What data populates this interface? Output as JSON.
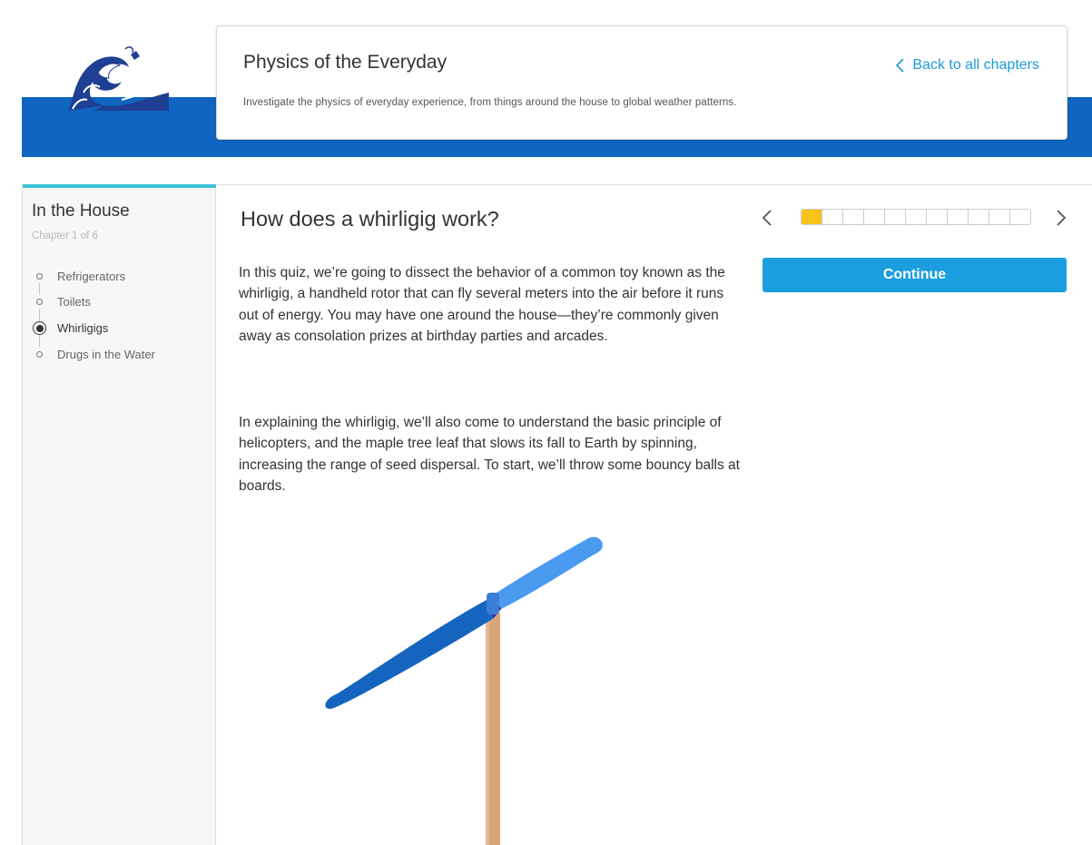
{
  "header": {
    "title": "Physics of the Everyday",
    "description": "Investigate the physics of everyday experience, from things around the house to global weather patterns.",
    "back_link": "Back to all chapters"
  },
  "sidebar": {
    "chapter_title": "In the House",
    "chapter_subtitle": "Chapter 1 of 6",
    "items": [
      {
        "label": "Refrigerators",
        "active": false
      },
      {
        "label": "Toilets",
        "active": false
      },
      {
        "label": "Whirligigs",
        "active": true
      },
      {
        "label": "Drugs in the Water",
        "active": false
      }
    ]
  },
  "quiz": {
    "title": "How does a whirligig work?",
    "paragraphs": [
      "In this quiz, we’re going to dissect the behavior of a common toy known as the whirligig, a handheld rotor that can fly several meters into the air before it runs out of energy. You may have one around the house—they’re commonly given away as consolation prizes at birthday parties and arcades.",
      "In explaining the whirligig, we’ll also come to understand the basic principle of helicopters, and the maple tree leaf that slows its fall to Earth by spinning, increasing the range of seed dispersal. To start, we’ll throw some bouncy balls at boards."
    ]
  },
  "navigation": {
    "continue_label": "Continue",
    "progress_total": 11,
    "progress_current": 1
  },
  "colors": {
    "brand_blue": "#0f65bf",
    "accent_teal": "#3bc3d8",
    "button_blue": "#1a9ee0",
    "progress_yellow": "#f7c21a",
    "link_blue": "#1b9ad6"
  },
  "icons": {
    "logo": "great-wave-logo",
    "back": "chevron-left-icon",
    "prev": "chevron-left-icon",
    "next": "chevron-right-icon"
  }
}
